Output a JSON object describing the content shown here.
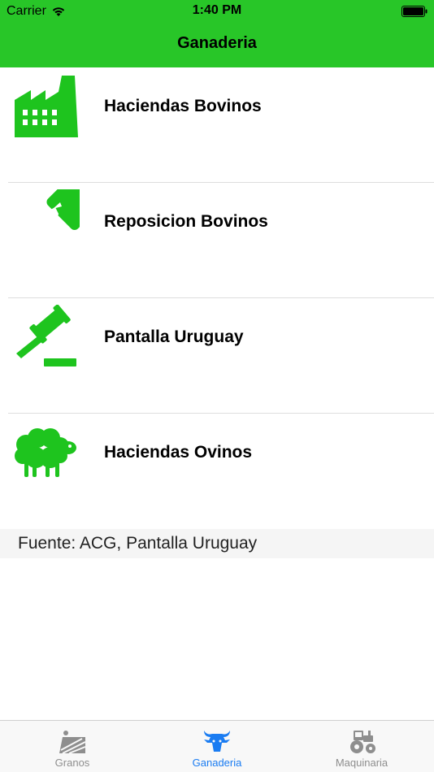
{
  "status_bar": {
    "carrier": "Carrier",
    "time": "1:40 PM"
  },
  "nav": {
    "title": "Ganaderia"
  },
  "colors": {
    "brand_green": "#28c628",
    "icon_green": "#1ec41e",
    "tab_active": "#1a7cf2",
    "tab_inactive": "#8e8e8e"
  },
  "list": {
    "items": [
      {
        "label": "Haciendas Bovinos",
        "icon": "factory-icon"
      },
      {
        "label": "Reposicion Bovinos",
        "icon": "cow-sign-icon"
      },
      {
        "label": "Pantalla Uruguay",
        "icon": "gavel-icon"
      },
      {
        "label": "Haciendas Ovinos",
        "icon": "sheep-icon"
      }
    ]
  },
  "footer": {
    "source": "Fuente: ACG, Pantalla Uruguay"
  },
  "tabs": [
    {
      "label": "Granos",
      "icon": "field-icon",
      "active": false
    },
    {
      "label": "Ganaderia",
      "icon": "bull-icon",
      "active": true
    },
    {
      "label": "Maquinaria",
      "icon": "tractor-icon",
      "active": false
    }
  ]
}
